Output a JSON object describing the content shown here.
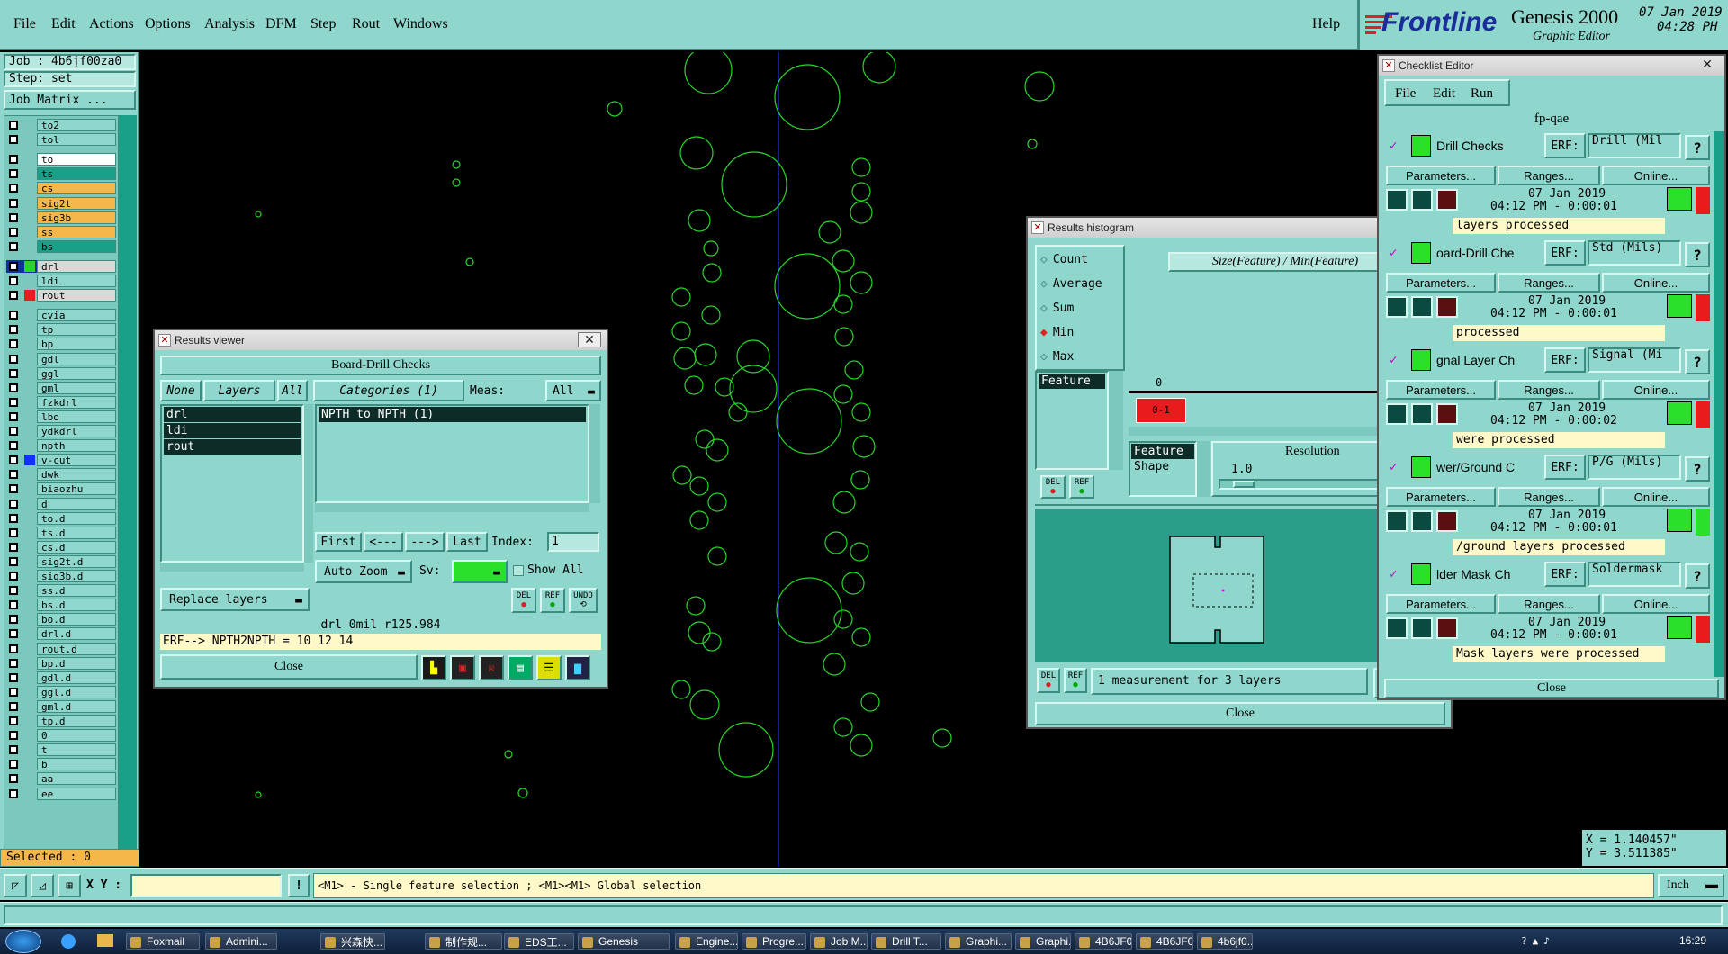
{
  "menubar": {
    "items": [
      "File",
      "Edit",
      "Actions",
      "Options",
      "Analysis",
      "DFM",
      "Step",
      "Rout",
      "Windows"
    ],
    "help": "Help"
  },
  "brand": {
    "logo": "Frontline",
    "product": "Genesis 2000",
    "subtitle": "Graphic Editor",
    "date": "07 Jan 2019",
    "time": "04:28 PH"
  },
  "job_panel": {
    "job": "Job : 4b6jf00za0",
    "step": "Step: set",
    "job_matrix": "Job Matrix ...",
    "selected": "Selected : 0"
  },
  "layers": [
    {
      "name": "to2",
      "color": ""
    },
    {
      "name": "tol",
      "color": ""
    },
    {
      "name": "to",
      "color": "#ffffff"
    },
    {
      "name": "ts",
      "color": "#1aa089"
    },
    {
      "name": "cs",
      "color": "#f5b74a"
    },
    {
      "name": "sig2t",
      "color": "#f5b74a"
    },
    {
      "name": "sig3b",
      "color": "#f5b74a"
    },
    {
      "name": "ss",
      "color": "#f5b74a"
    },
    {
      "name": "bs",
      "color": "#1aa089"
    },
    {
      "name": "drl",
      "color": "#29d629"
    },
    {
      "name": "ldi",
      "color": ""
    },
    {
      "name": "rout",
      "color": "#e81c1c"
    },
    {
      "name": "cvia",
      "color": ""
    },
    {
      "name": "tp",
      "color": ""
    },
    {
      "name": "bp",
      "color": ""
    },
    {
      "name": "gdl",
      "color": ""
    },
    {
      "name": "ggl",
      "color": ""
    },
    {
      "name": "gml",
      "color": ""
    },
    {
      "name": "fzkdrl",
      "color": ""
    },
    {
      "name": "lbo",
      "color": ""
    },
    {
      "name": "ydkdrl",
      "color": ""
    },
    {
      "name": "npth",
      "color": ""
    },
    {
      "name": "v-cut",
      "color": "#1230ff"
    },
    {
      "name": "dwk",
      "color": ""
    },
    {
      "name": "biaozhu",
      "color": ""
    },
    {
      "name": "d",
      "color": ""
    },
    {
      "name": "to.d",
      "color": ""
    },
    {
      "name": "ts.d",
      "color": ""
    },
    {
      "name": "cs.d",
      "color": ""
    },
    {
      "name": "sig2t.d",
      "color": ""
    },
    {
      "name": "sig3b.d",
      "color": ""
    },
    {
      "name": "ss.d",
      "color": ""
    },
    {
      "name": "bs.d",
      "color": ""
    },
    {
      "name": "bo.d",
      "color": ""
    },
    {
      "name": "drl.d",
      "color": ""
    },
    {
      "name": "rout.d",
      "color": ""
    },
    {
      "name": "bp.d",
      "color": ""
    },
    {
      "name": "gdl.d",
      "color": ""
    },
    {
      "name": "ggl.d",
      "color": ""
    },
    {
      "name": "gml.d",
      "color": ""
    },
    {
      "name": "tp.d",
      "color": ""
    },
    {
      "name": "0",
      "color": ""
    },
    {
      "name": "t",
      "color": ""
    },
    {
      "name": "b",
      "color": ""
    },
    {
      "name": "aa",
      "color": ""
    },
    {
      "name": "ee",
      "color": ""
    }
  ],
  "results_viewer": {
    "title": "Results viewer",
    "header": "Board-Drill Checks",
    "none": "None",
    "layers_label": "Layers",
    "all": "All",
    "categories": "Categories (1)",
    "meas_label": "Meas:",
    "meas_value": "All",
    "layer_items": [
      "drl",
      "ldi",
      "rout"
    ],
    "category_items": [
      "NPTH to NPTH  (1)"
    ],
    "nav": [
      "First",
      "<---",
      "--->",
      "Last"
    ],
    "index_label": "Index:",
    "index_value": "1",
    "zoom": "Auto Zoom",
    "sv_label": "Sv:",
    "show_all": "Show All",
    "replace_layers": "Replace layers",
    "del": "DEL",
    "ref": "REF",
    "undo": "UNDO",
    "status": "drl 0mil  r125.984",
    "erf": "ERF--> NPTH2NPTH = 10 12 14",
    "close": "Close"
  },
  "histogram": {
    "title": "Results histogram",
    "options": [
      "Count",
      "Average",
      "Sum",
      "Min",
      "Max"
    ],
    "selected_option": "Min",
    "formula": "Size(Feature) / Min(Feature)",
    "left_item": "Feature",
    "bin_count": "0",
    "bin_label": "0-1",
    "feature_list": [
      "Feature",
      "Shape"
    ],
    "resolution_label": "Resolution",
    "resolution_value": "1.0",
    "del": "DEL",
    "ref": "REF",
    "measurement": "1 measurement for 3 layers",
    "close": "Close"
  },
  "checklist": {
    "title": "Checklist Editor",
    "menu": [
      "File",
      "Edit",
      "Run"
    ],
    "name": "fp-qae",
    "erf_label": "ERF:",
    "actions": [
      "Parameters...",
      "Ranges...",
      "Online..."
    ],
    "checks": [
      {
        "name": "Drill Checks",
        "erf": "Drill (Mil",
        "date": "07 Jan 2019",
        "time": "04:12 PM - 0:00:01",
        "msg": "layers processed"
      },
      {
        "name": "oard-Drill Che",
        "erf": "Std (Mils)",
        "date": "07 Jan 2019",
        "time": "04:12 PM - 0:00:01",
        "msg": "processed"
      },
      {
        "name": "gnal Layer Ch",
        "erf": "Signal (Mi",
        "date": "07 Jan 2019",
        "time": "04:12 PM - 0:00:02",
        "msg": "were processed"
      },
      {
        "name": "wer/Ground C",
        "erf": "P/G (Mils)",
        "date": "07 Jan 2019",
        "time": "04:12 PM - 0:00:01",
        "msg": "/ground layers processed"
      },
      {
        "name": "lder Mask Ch",
        "erf": "Soldermask",
        "date": "07 Jan 2019",
        "time": "04:12 PM - 0:00:01",
        "msg": "Mask layers were processed"
      }
    ],
    "close": "Close"
  },
  "coords": {
    "x": "X = 1.140457\"",
    "y": "Y = 3.511385\""
  },
  "statusbar": {
    "xy_label": "X Y :",
    "hint": "<M1> - Single feature selection ; <M1><M1> Global selection",
    "units": "Inch"
  },
  "taskbar": {
    "items": [
      "Foxmail",
      "Admini...",
      "兴森快...",
      "制作规...",
      "EDS工...",
      "Genesis",
      "Engine...",
      "Progre...",
      "Job M...",
      "Drill T...",
      "Graphi...",
      "Graphi...",
      "4B6JF0...",
      "4B6JF0...",
      "4b6jf0..."
    ],
    "clock": "16:29"
  }
}
